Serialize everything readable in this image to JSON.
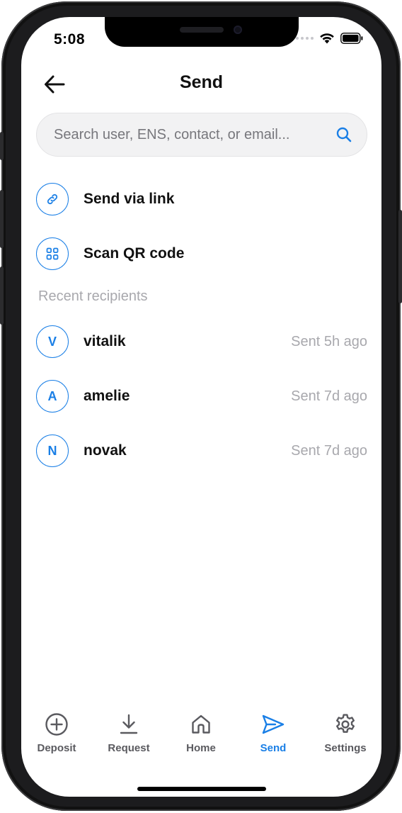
{
  "status_bar": {
    "time": "5:08"
  },
  "header": {
    "title": "Send"
  },
  "search": {
    "placeholder": "Search user, ENS, contact, or email..."
  },
  "actions": [
    {
      "label": "Send via link",
      "icon": "link-icon"
    },
    {
      "label": "Scan QR code",
      "icon": "qr-grid-icon"
    }
  ],
  "recent": {
    "section_label": "Recent recipients",
    "items": [
      {
        "initial": "V",
        "name": "vitalik",
        "meta": "Sent 5h ago"
      },
      {
        "initial": "A",
        "name": "amelie",
        "meta": "Sent 7d ago"
      },
      {
        "initial": "N",
        "name": "novak",
        "meta": "Sent 7d ago"
      }
    ]
  },
  "nav": {
    "items": [
      {
        "label": "Deposit",
        "icon": "plus-circle-icon"
      },
      {
        "label": "Request",
        "icon": "download-icon"
      },
      {
        "label": "Home",
        "icon": "home-icon"
      },
      {
        "label": "Send",
        "icon": "send-icon",
        "active": true
      },
      {
        "label": "Settings",
        "icon": "gear-icon"
      }
    ]
  },
  "colors": {
    "accent": "#1a7fe6",
    "muted_text": "#a8a8ad",
    "search_bg": "#f2f2f3"
  }
}
